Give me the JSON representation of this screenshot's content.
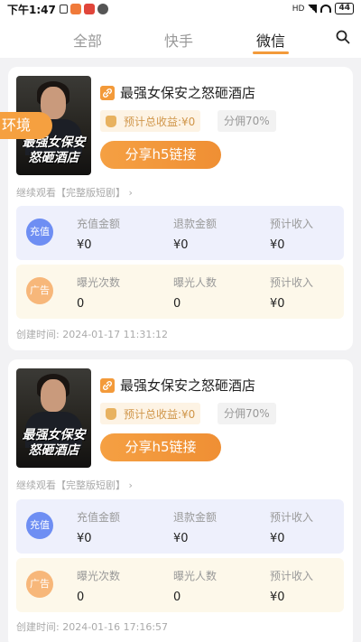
{
  "status_bar": {
    "time": "下午1:47",
    "battery": "44",
    "network": "HD"
  },
  "tabs": [
    {
      "label": "全部",
      "active": false
    },
    {
      "label": "快手",
      "active": false
    },
    {
      "label": "微信",
      "active": true
    }
  ],
  "cards": [
    {
      "title": "最强女保安之怒砸酒店",
      "cover_text": "最强女保安怒砸酒店",
      "env_tag": "环境",
      "income_label": "预计总收益:¥0",
      "share_ratio": "分佣70%",
      "share_button": "分享h5链接",
      "continue_link": "继续观看【完整版短剧】",
      "recharge": {
        "badge": "充值",
        "columns": [
          {
            "label": "充值金额",
            "value": "¥0"
          },
          {
            "label": "退款金额",
            "value": "¥0"
          },
          {
            "label": "预计收入",
            "value": "¥0"
          }
        ]
      },
      "ad": {
        "badge": "广告",
        "columns": [
          {
            "label": "曝光次数",
            "value": "0"
          },
          {
            "label": "曝光人数",
            "value": "0"
          },
          {
            "label": "预计收入",
            "value": "¥0"
          }
        ]
      },
      "created": "创建时间: 2024-01-17 11:31:12"
    },
    {
      "title": "最强女保安之怒砸酒店",
      "cover_text": "最强女保安怒砸酒店",
      "share_ratio": "分佣70%",
      "income_label": "预计总收益:¥0",
      "share_button": "分享h5链接",
      "continue_link": "继续观看【完整版短剧】",
      "recharge": {
        "badge": "充值",
        "columns": [
          {
            "label": "充值金额",
            "value": "¥0"
          },
          {
            "label": "退款金额",
            "value": "¥0"
          },
          {
            "label": "预计收入",
            "value": "¥0"
          }
        ]
      },
      "ad": {
        "badge": "广告",
        "columns": [
          {
            "label": "曝光次数",
            "value": "0"
          },
          {
            "label": "曝光人数",
            "value": "0"
          },
          {
            "label": "预计收入",
            "value": "¥0"
          }
        ]
      },
      "created": "创建时间: 2024-01-16 17:16:57"
    }
  ],
  "colors": {
    "accent": "#f39a3a",
    "recharge_bg": "#eef0fc",
    "ad_bg": "#fdf8ea"
  }
}
